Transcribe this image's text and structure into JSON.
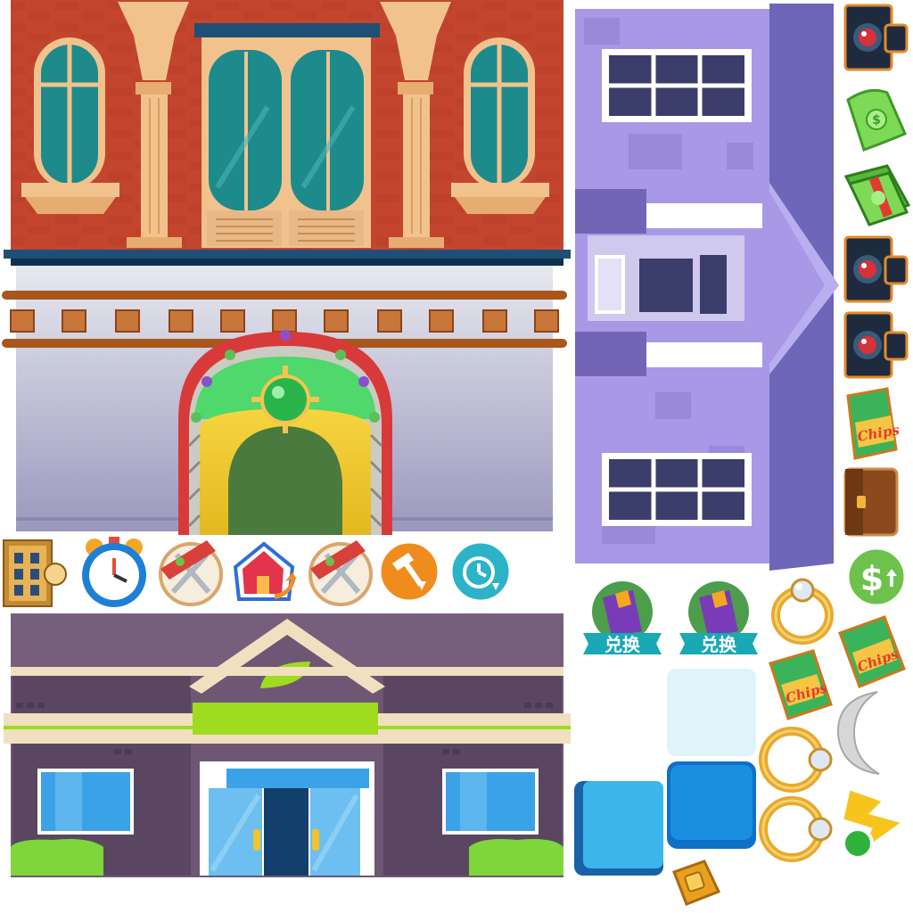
{
  "sheet": {
    "background": "#ffffff",
    "assets": {
      "red_building_facade": {
        "icon": "red-brick-building-facade"
      },
      "purple_house_roof": {
        "icon": "purple-house-top-down"
      },
      "purple_shop_facade": {
        "icon": "purple-shop-facade-with-leaf-sign"
      },
      "building_thumbnail": {
        "icon": "building-thumbnail-icon"
      },
      "alarm_clock": {
        "icon": "alarm-clock-icon"
      },
      "cutlery_plate_1": {
        "icon": "cutlery-plate-icon"
      },
      "house_upgrade": {
        "icon": "house-upgrade-icon"
      },
      "cutlery_plate_2": {
        "icon": "cutlery-plate-icon"
      },
      "hammer_orange": {
        "icon": "hammer-down-icon"
      },
      "clock_speedup": {
        "icon": "clock-speedup-icon"
      },
      "camera_1": {
        "icon": "camera-icon"
      },
      "cash_single": {
        "icon": "cash-bill-icon"
      },
      "cash_stack": {
        "icon": "cash-stack-icon"
      },
      "camera_2": {
        "icon": "camera-icon"
      },
      "camera_3": {
        "icon": "camera-icon"
      },
      "chips_1": {
        "icon": "chips-bag-icon",
        "label": "Chips"
      },
      "briefcase": {
        "icon": "briefcase-icon"
      },
      "dollar_up": {
        "icon": "dollar-up-icon",
        "symbol": "$"
      },
      "exchange_1": {
        "icon": "exchange-gift-icon",
        "label": "兑换"
      },
      "exchange_2": {
        "icon": "exchange-gift-icon",
        "label": "兑换"
      },
      "ring_1": {
        "icon": "diamond-ring-icon"
      },
      "chips_2": {
        "icon": "chips-bag-icon",
        "label": "Chips"
      },
      "chips_3": {
        "icon": "chips-bag-icon",
        "label": "Chips"
      },
      "tile_light": {
        "icon": "light-blue-tile"
      },
      "moon": {
        "icon": "crescent-moon-icon"
      },
      "ring_2": {
        "icon": "diamond-ring-icon"
      },
      "tile_blue": {
        "icon": "blue-tile"
      },
      "tile_cyan": {
        "icon": "cyan-tile"
      },
      "ring_3": {
        "icon": "diamond-ring-icon"
      },
      "lightning": {
        "icon": "lightning-bolt-icon"
      },
      "gold_bag": {
        "icon": "gold-bag-icon"
      }
    },
    "colors": {
      "brick": "#c4452e",
      "purple_house": "#a898e6",
      "shop_purple": "#6e5775",
      "accent_green": "#9fdb1f",
      "tile_blue": "#1a8fe0",
      "gold": "#e8a830"
    }
  }
}
